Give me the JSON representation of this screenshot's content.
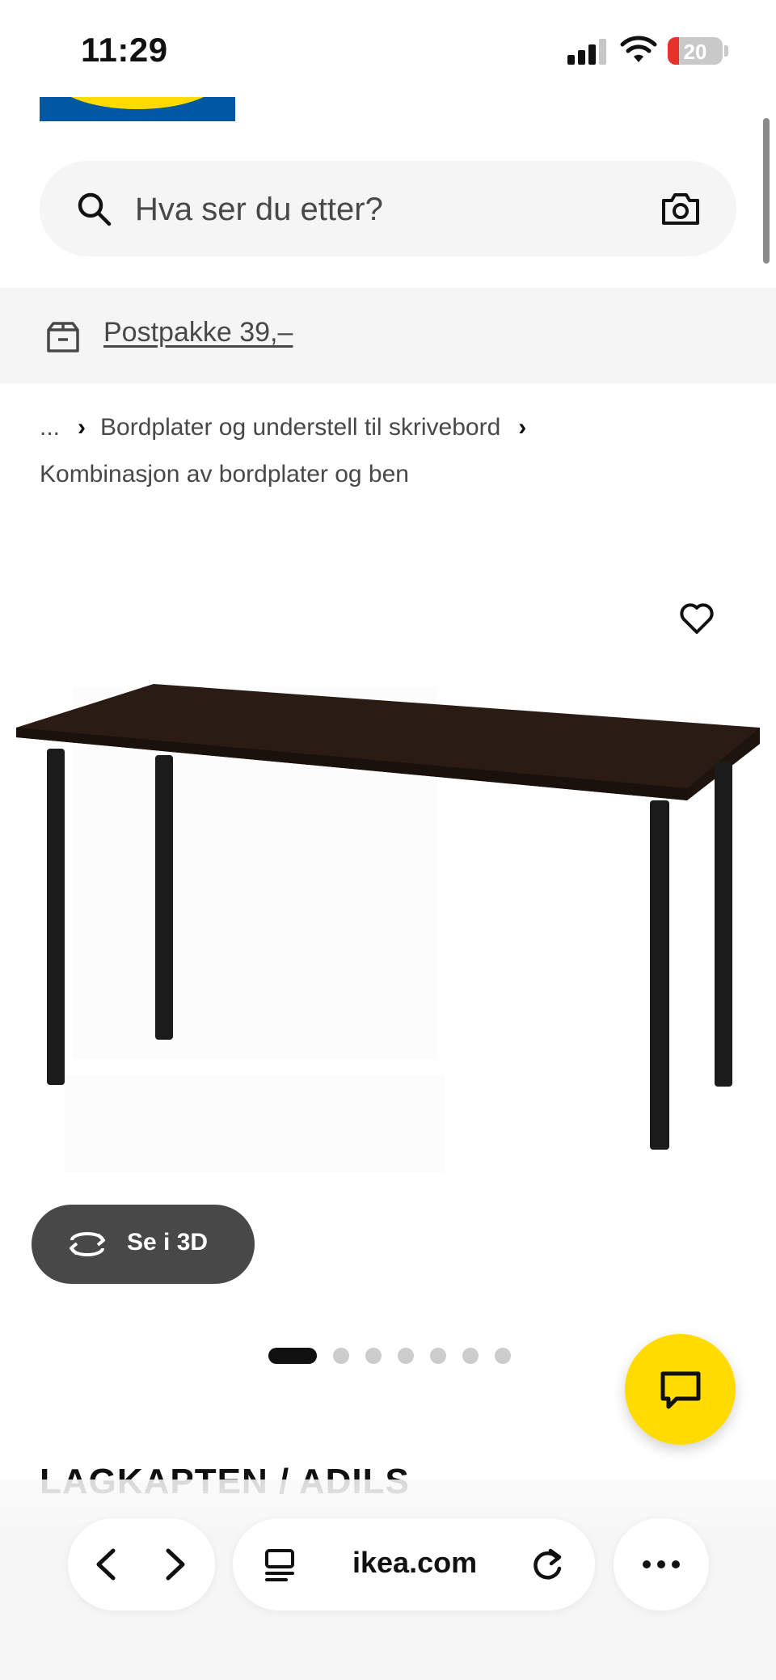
{
  "status_bar": {
    "time": "11:29",
    "battery_level": "20",
    "battery_fraction": 0.2
  },
  "search": {
    "placeholder": "Hva ser du etter?"
  },
  "delivery_banner": {
    "link_text": "Postpakke 39,–"
  },
  "breadcrumb": {
    "ellipsis": "...",
    "items": [
      "Bordplater og understell til skrivebord",
      "Kombinasjon av bordplater og ben"
    ]
  },
  "product": {
    "view_3d_label": "Se i 3D",
    "title_partial": "LAGKAPTEN / ADILS",
    "carousel": {
      "total": 7,
      "active_index": 1
    }
  },
  "browser": {
    "domain": "ikea.com"
  },
  "colors": {
    "brand_blue": "#0058a3",
    "brand_yellow": "#ffdb00",
    "battery_red": "#e5332a"
  },
  "icons": [
    "search-icon",
    "camera-icon",
    "box-icon",
    "heart-icon",
    "rotate-3d-icon",
    "chat-icon",
    "chevron-left-icon",
    "chevron-right-icon",
    "reader-icon",
    "reload-icon",
    "more-icon"
  ]
}
